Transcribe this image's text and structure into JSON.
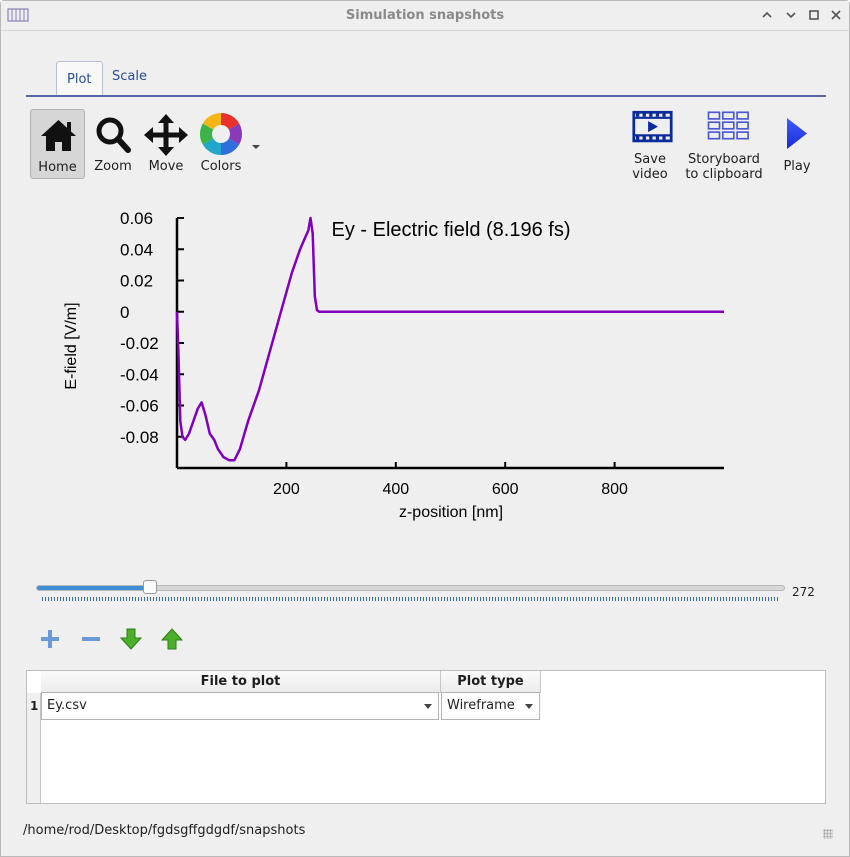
{
  "window": {
    "title": "Simulation snapshots"
  },
  "tabs": [
    {
      "label": "Plot",
      "active": true
    },
    {
      "label": "Scale",
      "active": false
    }
  ],
  "toolbar": {
    "home": "Home",
    "zoom": "Zoom",
    "move": "Move",
    "colors": "Colors",
    "save_video_1": "Save",
    "save_video_2": "video",
    "storyboard_1": "Storyboard",
    "storyboard_2": "to clipboard",
    "play": "Play"
  },
  "chart_data": {
    "type": "line",
    "title": "Ey - Electric field (8.196 fs)",
    "xlabel": "z-position [nm]",
    "ylabel": "E-field [V/m]",
    "xlim": [
      0,
      1000
    ],
    "ylim": [
      -0.1,
      0.06
    ],
    "xticks": [
      200,
      400,
      600,
      800
    ],
    "yticks": [
      0.06,
      0.04,
      0.02,
      0,
      -0.02,
      -0.04,
      -0.06,
      -0.08
    ],
    "yticklabels": [
      "0.06",
      "0.04",
      "0.02",
      "0",
      "-0.02",
      "-0.04",
      "-0.06",
      "-0.08"
    ],
    "grid": false,
    "series": [
      {
        "color": "#8000c0",
        "x": [
          0,
          3,
          6,
          10,
          15,
          22,
          30,
          38,
          45,
          52,
          60,
          68,
          75,
          85,
          95,
          105,
          115,
          130,
          150,
          170,
          190,
          210,
          225,
          235,
          240,
          244,
          248,
          252,
          256,
          260,
          300,
          500,
          700,
          1000
        ],
        "y": [
          0,
          -0.03,
          -0.07,
          -0.08,
          -0.082,
          -0.078,
          -0.07,
          -0.062,
          -0.058,
          -0.066,
          -0.078,
          -0.082,
          -0.088,
          -0.093,
          -0.095,
          -0.095,
          -0.088,
          -0.07,
          -0.05,
          -0.025,
          0.0,
          0.025,
          0.04,
          0.048,
          0.052,
          0.06,
          0.05,
          0.01,
          0.001,
          0.0,
          0.0,
          0.0,
          0.0,
          0.0
        ]
      }
    ]
  },
  "slider": {
    "value": 272,
    "value_label": "272",
    "fraction": 0.152
  },
  "table": {
    "headers": [
      "File to plot",
      "Plot type"
    ],
    "rows": [
      {
        "num": "1",
        "file": "Ey.csv",
        "plot_type": "Wireframe"
      }
    ]
  },
  "status": {
    "path": "/home/rod/Desktop/fgdsgffgdgdf/snapshots"
  },
  "colors": {
    "accent": "#5766a8",
    "series": "#8000c0",
    "slider": "#3d8fd6"
  }
}
